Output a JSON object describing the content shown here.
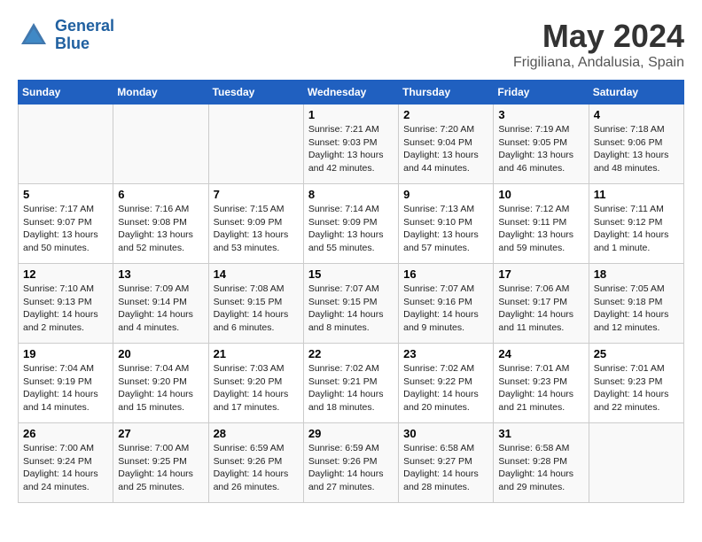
{
  "header": {
    "logo_line1": "General",
    "logo_line2": "Blue",
    "main_title": "May 2024",
    "subtitle": "Frigiliana, Andalusia, Spain"
  },
  "weekdays": [
    "Sunday",
    "Monday",
    "Tuesday",
    "Wednesday",
    "Thursday",
    "Friday",
    "Saturday"
  ],
  "weeks": [
    [
      {
        "day": "",
        "text": ""
      },
      {
        "day": "",
        "text": ""
      },
      {
        "day": "",
        "text": ""
      },
      {
        "day": "1",
        "text": "Sunrise: 7:21 AM\nSunset: 9:03 PM\nDaylight: 13 hours\nand 42 minutes."
      },
      {
        "day": "2",
        "text": "Sunrise: 7:20 AM\nSunset: 9:04 PM\nDaylight: 13 hours\nand 44 minutes."
      },
      {
        "day": "3",
        "text": "Sunrise: 7:19 AM\nSunset: 9:05 PM\nDaylight: 13 hours\nand 46 minutes."
      },
      {
        "day": "4",
        "text": "Sunrise: 7:18 AM\nSunset: 9:06 PM\nDaylight: 13 hours\nand 48 minutes."
      }
    ],
    [
      {
        "day": "5",
        "text": "Sunrise: 7:17 AM\nSunset: 9:07 PM\nDaylight: 13 hours\nand 50 minutes."
      },
      {
        "day": "6",
        "text": "Sunrise: 7:16 AM\nSunset: 9:08 PM\nDaylight: 13 hours\nand 52 minutes."
      },
      {
        "day": "7",
        "text": "Sunrise: 7:15 AM\nSunset: 9:09 PM\nDaylight: 13 hours\nand 53 minutes."
      },
      {
        "day": "8",
        "text": "Sunrise: 7:14 AM\nSunset: 9:09 PM\nDaylight: 13 hours\nand 55 minutes."
      },
      {
        "day": "9",
        "text": "Sunrise: 7:13 AM\nSunset: 9:10 PM\nDaylight: 13 hours\nand 57 minutes."
      },
      {
        "day": "10",
        "text": "Sunrise: 7:12 AM\nSunset: 9:11 PM\nDaylight: 13 hours\nand 59 minutes."
      },
      {
        "day": "11",
        "text": "Sunrise: 7:11 AM\nSunset: 9:12 PM\nDaylight: 14 hours\nand 1 minute."
      }
    ],
    [
      {
        "day": "12",
        "text": "Sunrise: 7:10 AM\nSunset: 9:13 PM\nDaylight: 14 hours\nand 2 minutes."
      },
      {
        "day": "13",
        "text": "Sunrise: 7:09 AM\nSunset: 9:14 PM\nDaylight: 14 hours\nand 4 minutes."
      },
      {
        "day": "14",
        "text": "Sunrise: 7:08 AM\nSunset: 9:15 PM\nDaylight: 14 hours\nand 6 minutes."
      },
      {
        "day": "15",
        "text": "Sunrise: 7:07 AM\nSunset: 9:15 PM\nDaylight: 14 hours\nand 8 minutes."
      },
      {
        "day": "16",
        "text": "Sunrise: 7:07 AM\nSunset: 9:16 PM\nDaylight: 14 hours\nand 9 minutes."
      },
      {
        "day": "17",
        "text": "Sunrise: 7:06 AM\nSunset: 9:17 PM\nDaylight: 14 hours\nand 11 minutes."
      },
      {
        "day": "18",
        "text": "Sunrise: 7:05 AM\nSunset: 9:18 PM\nDaylight: 14 hours\nand 12 minutes."
      }
    ],
    [
      {
        "day": "19",
        "text": "Sunrise: 7:04 AM\nSunset: 9:19 PM\nDaylight: 14 hours\nand 14 minutes."
      },
      {
        "day": "20",
        "text": "Sunrise: 7:04 AM\nSunset: 9:20 PM\nDaylight: 14 hours\nand 15 minutes."
      },
      {
        "day": "21",
        "text": "Sunrise: 7:03 AM\nSunset: 9:20 PM\nDaylight: 14 hours\nand 17 minutes."
      },
      {
        "day": "22",
        "text": "Sunrise: 7:02 AM\nSunset: 9:21 PM\nDaylight: 14 hours\nand 18 minutes."
      },
      {
        "day": "23",
        "text": "Sunrise: 7:02 AM\nSunset: 9:22 PM\nDaylight: 14 hours\nand 20 minutes."
      },
      {
        "day": "24",
        "text": "Sunrise: 7:01 AM\nSunset: 9:23 PM\nDaylight: 14 hours\nand 21 minutes."
      },
      {
        "day": "25",
        "text": "Sunrise: 7:01 AM\nSunset: 9:23 PM\nDaylight: 14 hours\nand 22 minutes."
      }
    ],
    [
      {
        "day": "26",
        "text": "Sunrise: 7:00 AM\nSunset: 9:24 PM\nDaylight: 14 hours\nand 24 minutes."
      },
      {
        "day": "27",
        "text": "Sunrise: 7:00 AM\nSunset: 9:25 PM\nDaylight: 14 hours\nand 25 minutes."
      },
      {
        "day": "28",
        "text": "Sunrise: 6:59 AM\nSunset: 9:26 PM\nDaylight: 14 hours\nand 26 minutes."
      },
      {
        "day": "29",
        "text": "Sunrise: 6:59 AM\nSunset: 9:26 PM\nDaylight: 14 hours\nand 27 minutes."
      },
      {
        "day": "30",
        "text": "Sunrise: 6:58 AM\nSunset: 9:27 PM\nDaylight: 14 hours\nand 28 minutes."
      },
      {
        "day": "31",
        "text": "Sunrise: 6:58 AM\nSunset: 9:28 PM\nDaylight: 14 hours\nand 29 minutes."
      },
      {
        "day": "",
        "text": ""
      }
    ]
  ]
}
